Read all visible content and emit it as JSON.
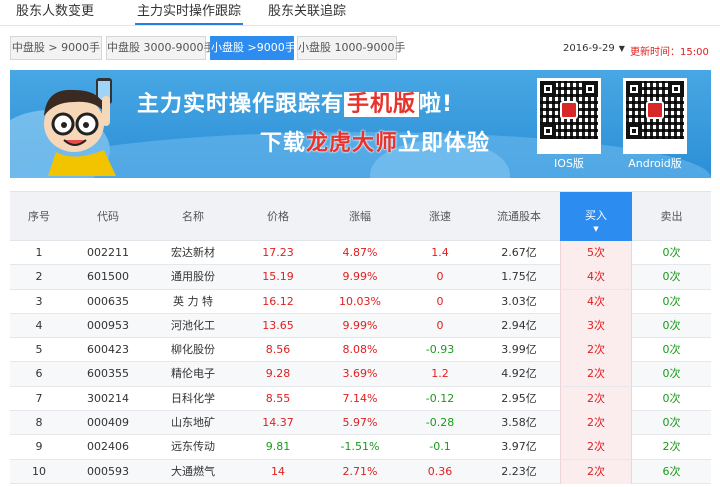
{
  "topnav": {
    "tabs": [
      {
        "label": "股东人数变更",
        "active": false
      },
      {
        "label": "主力实时操作跟踪",
        "active": true
      },
      {
        "label": "股东关联追踪",
        "active": false
      }
    ]
  },
  "subtabs": [
    {
      "label": "中盘股 > 9000手",
      "active": false
    },
    {
      "label": "中盘股 3000-9000手",
      "active": false
    },
    {
      "label": "小盘股 >9000手",
      "active": true
    },
    {
      "label": "小盘股 1000-9000手",
      "active": false
    }
  ],
  "date": {
    "value": "2016-9-29"
  },
  "update": {
    "label": "更新时间：",
    "time": "15:00"
  },
  "banner": {
    "line1_a": "主力实时操作跟踪有",
    "line1_hl": "手机版",
    "line1_b": "啦!",
    "line2_a": "下载",
    "line2_hl": "龙虎大师",
    "line2_b": "立即体验",
    "qr_ios_label": "IOS版",
    "qr_android_label": "Android版"
  },
  "table": {
    "headers": [
      "序号",
      "代码",
      "名称",
      "价格",
      "涨幅",
      "涨速",
      "流通股本",
      "买入",
      "卖出"
    ],
    "sort_column": "买入",
    "rows": [
      {
        "idx": "1",
        "code": "002211",
        "name": "宏达新材",
        "price": "17.23",
        "change": "4.87%",
        "speed": "1.4",
        "float": "2.67亿",
        "buy": "5次",
        "sell": "0次"
      },
      {
        "idx": "2",
        "code": "601500",
        "name": "通用股份",
        "price": "15.19",
        "change": "9.99%",
        "speed": "0",
        "float": "1.75亿",
        "buy": "4次",
        "sell": "0次"
      },
      {
        "idx": "3",
        "code": "000635",
        "name": "英 力 特",
        "price": "16.12",
        "change": "10.03%",
        "speed": "0",
        "float": "3.03亿",
        "buy": "4次",
        "sell": "0次"
      },
      {
        "idx": "4",
        "code": "000953",
        "name": "河池化工",
        "price": "13.65",
        "change": "9.99%",
        "speed": "0",
        "float": "2.94亿",
        "buy": "3次",
        "sell": "0次"
      },
      {
        "idx": "5",
        "code": "600423",
        "name": "柳化股份",
        "price": "8.56",
        "change": "8.08%",
        "speed": "-0.93",
        "float": "3.99亿",
        "buy": "2次",
        "sell": "0次"
      },
      {
        "idx": "6",
        "code": "600355",
        "name": "精伦电子",
        "price": "9.28",
        "change": "3.69%",
        "speed": "1.2",
        "float": "4.92亿",
        "buy": "2次",
        "sell": "0次"
      },
      {
        "idx": "7",
        "code": "300214",
        "name": "日科化学",
        "price": "8.55",
        "change": "7.14%",
        "speed": "-0.12",
        "float": "2.95亿",
        "buy": "2次",
        "sell": "0次"
      },
      {
        "idx": "8",
        "code": "000409",
        "name": "山东地矿",
        "price": "14.37",
        "change": "5.97%",
        "speed": "-0.28",
        "float": "3.58亿",
        "buy": "2次",
        "sell": "0次"
      },
      {
        "idx": "9",
        "code": "002406",
        "name": "远东传动",
        "price": "9.81",
        "change": "-1.51%",
        "speed": "-0.1",
        "float": "3.97亿",
        "buy": "2次",
        "sell": "2次"
      },
      {
        "idx": "10",
        "code": "000593",
        "name": "大通燃气",
        "price": "14",
        "change": "2.71%",
        "speed": "0.36",
        "float": "2.23亿",
        "buy": "2次",
        "sell": "6次"
      }
    ]
  },
  "colors": {
    "accent": "#2d8cf0",
    "up": "#e02020",
    "down": "#1a9a1a"
  }
}
